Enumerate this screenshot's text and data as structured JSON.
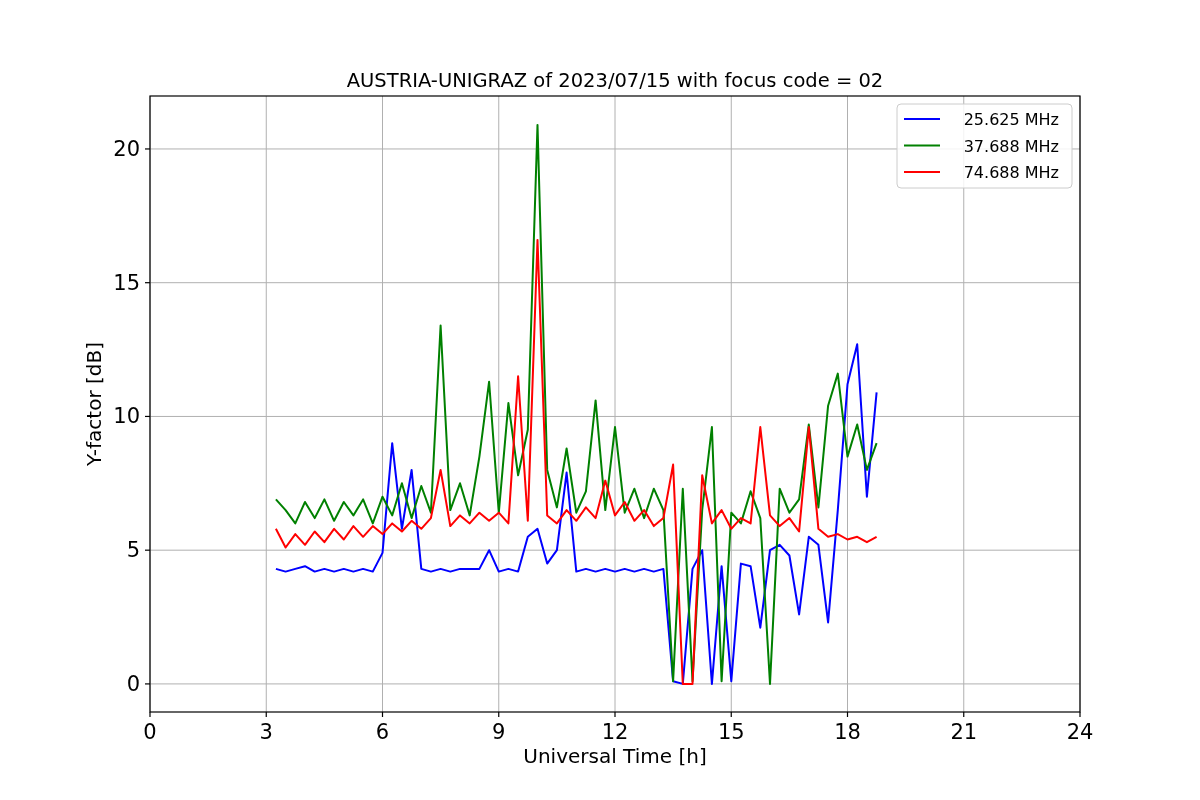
{
  "figure": {
    "chart_data": {
      "type": "line",
      "title": "AUSTRIA-UNIGRAZ of 2023/07/15 with focus code = 02",
      "xlabel": "Universal Time [h]",
      "ylabel": "Y-factor [dB]",
      "x": [
        3.25,
        3.5,
        3.75,
        4,
        4.25,
        4.5,
        4.75,
        5,
        5.25,
        5.5,
        5.75,
        6,
        6.25,
        6.5,
        6.75,
        7,
        7.25,
        7.5,
        7.75,
        8,
        8.25,
        8.5,
        8.75,
        9,
        9.25,
        9.5,
        9.75,
        10,
        10.25,
        10.5,
        10.75,
        11,
        11.25,
        11.5,
        11.75,
        12,
        12.25,
        12.5,
        12.75,
        13,
        13.25,
        13.5,
        13.75,
        14,
        14.25,
        14.5,
        14.75,
        15,
        15.25,
        15.5,
        15.75,
        16,
        16.25,
        16.5,
        16.75,
        17,
        17.25,
        17.5,
        17.75,
        18,
        18.25,
        18.5,
        18.75
      ],
      "series": [
        {
          "name": "25.625 MHz",
          "color": "#0000ff",
          "values": [
            4.3,
            4.2,
            4.3,
            4.4,
            4.2,
            4.3,
            4.2,
            4.3,
            4.2,
            4.3,
            4.2,
            4.9,
            9.0,
            5.8,
            8.0,
            4.3,
            4.2,
            4.3,
            4.2,
            4.3,
            4.3,
            4.3,
            5.0,
            4.2,
            4.3,
            4.2,
            5.5,
            5.8,
            4.5,
            5.0,
            7.9,
            4.2,
            4.3,
            4.2,
            4.3,
            4.2,
            4.3,
            4.2,
            4.3,
            4.2,
            4.3,
            0.1,
            0.0,
            4.3,
            5.0,
            0.0,
            4.4,
            0.1,
            4.5,
            4.4,
            2.1,
            5.0,
            5.2,
            4.8,
            2.6,
            5.5,
            5.2,
            2.3,
            6.5,
            11.2,
            12.7,
            7.0,
            10.9
          ]
        },
        {
          "name": "37.688 MHz",
          "color": "#008000",
          "values": [
            6.9,
            6.5,
            6.0,
            6.8,
            6.2,
            6.9,
            6.1,
            6.8,
            6.3,
            6.9,
            6.0,
            7.0,
            6.3,
            7.5,
            6.2,
            7.4,
            6.4,
            13.4,
            6.5,
            7.5,
            6.3,
            8.5,
            11.3,
            6.4,
            10.5,
            7.8,
            9.5,
            20.9,
            8.0,
            6.6,
            8.8,
            6.4,
            7.2,
            10.6,
            6.5,
            9.6,
            6.4,
            7.3,
            6.2,
            7.3,
            6.5,
            0.1,
            7.3,
            0.1,
            6.5,
            9.6,
            0.1,
            6.4,
            6.0,
            7.2,
            6.2,
            0.0,
            7.3,
            6.4,
            6.9,
            9.7,
            6.6,
            10.4,
            11.6,
            8.5,
            9.7,
            8.0,
            9.0
          ]
        },
        {
          "name": "74.688 MHz",
          "color": "#ff0000",
          "values": [
            5.8,
            5.1,
            5.6,
            5.2,
            5.7,
            5.3,
            5.8,
            5.4,
            5.9,
            5.5,
            5.9,
            5.6,
            6.0,
            5.7,
            6.1,
            5.8,
            6.2,
            8.0,
            5.9,
            6.3,
            6.0,
            6.4,
            6.1,
            6.4,
            6.0,
            11.5,
            6.1,
            16.6,
            6.3,
            6.0,
            6.5,
            6.1,
            6.6,
            6.2,
            7.6,
            6.3,
            6.8,
            6.1,
            6.5,
            5.9,
            6.2,
            8.2,
            0.0,
            0.0,
            7.8,
            6.0,
            6.5,
            5.8,
            6.2,
            6.0,
            9.6,
            6.3,
            5.9,
            6.2,
            5.7,
            9.6,
            5.8,
            5.5,
            5.6,
            5.4,
            5.5,
            5.3,
            5.5
          ]
        }
      ],
      "grid": true,
      "legend": true,
      "xlim": [
        0,
        24
      ],
      "ylim": [
        -1.05,
        21.98
      ],
      "xticks": [
        0,
        3,
        6,
        9,
        12,
        15,
        18,
        21,
        24
      ],
      "yticks": [
        0,
        5,
        10,
        15,
        20
      ]
    }
  }
}
